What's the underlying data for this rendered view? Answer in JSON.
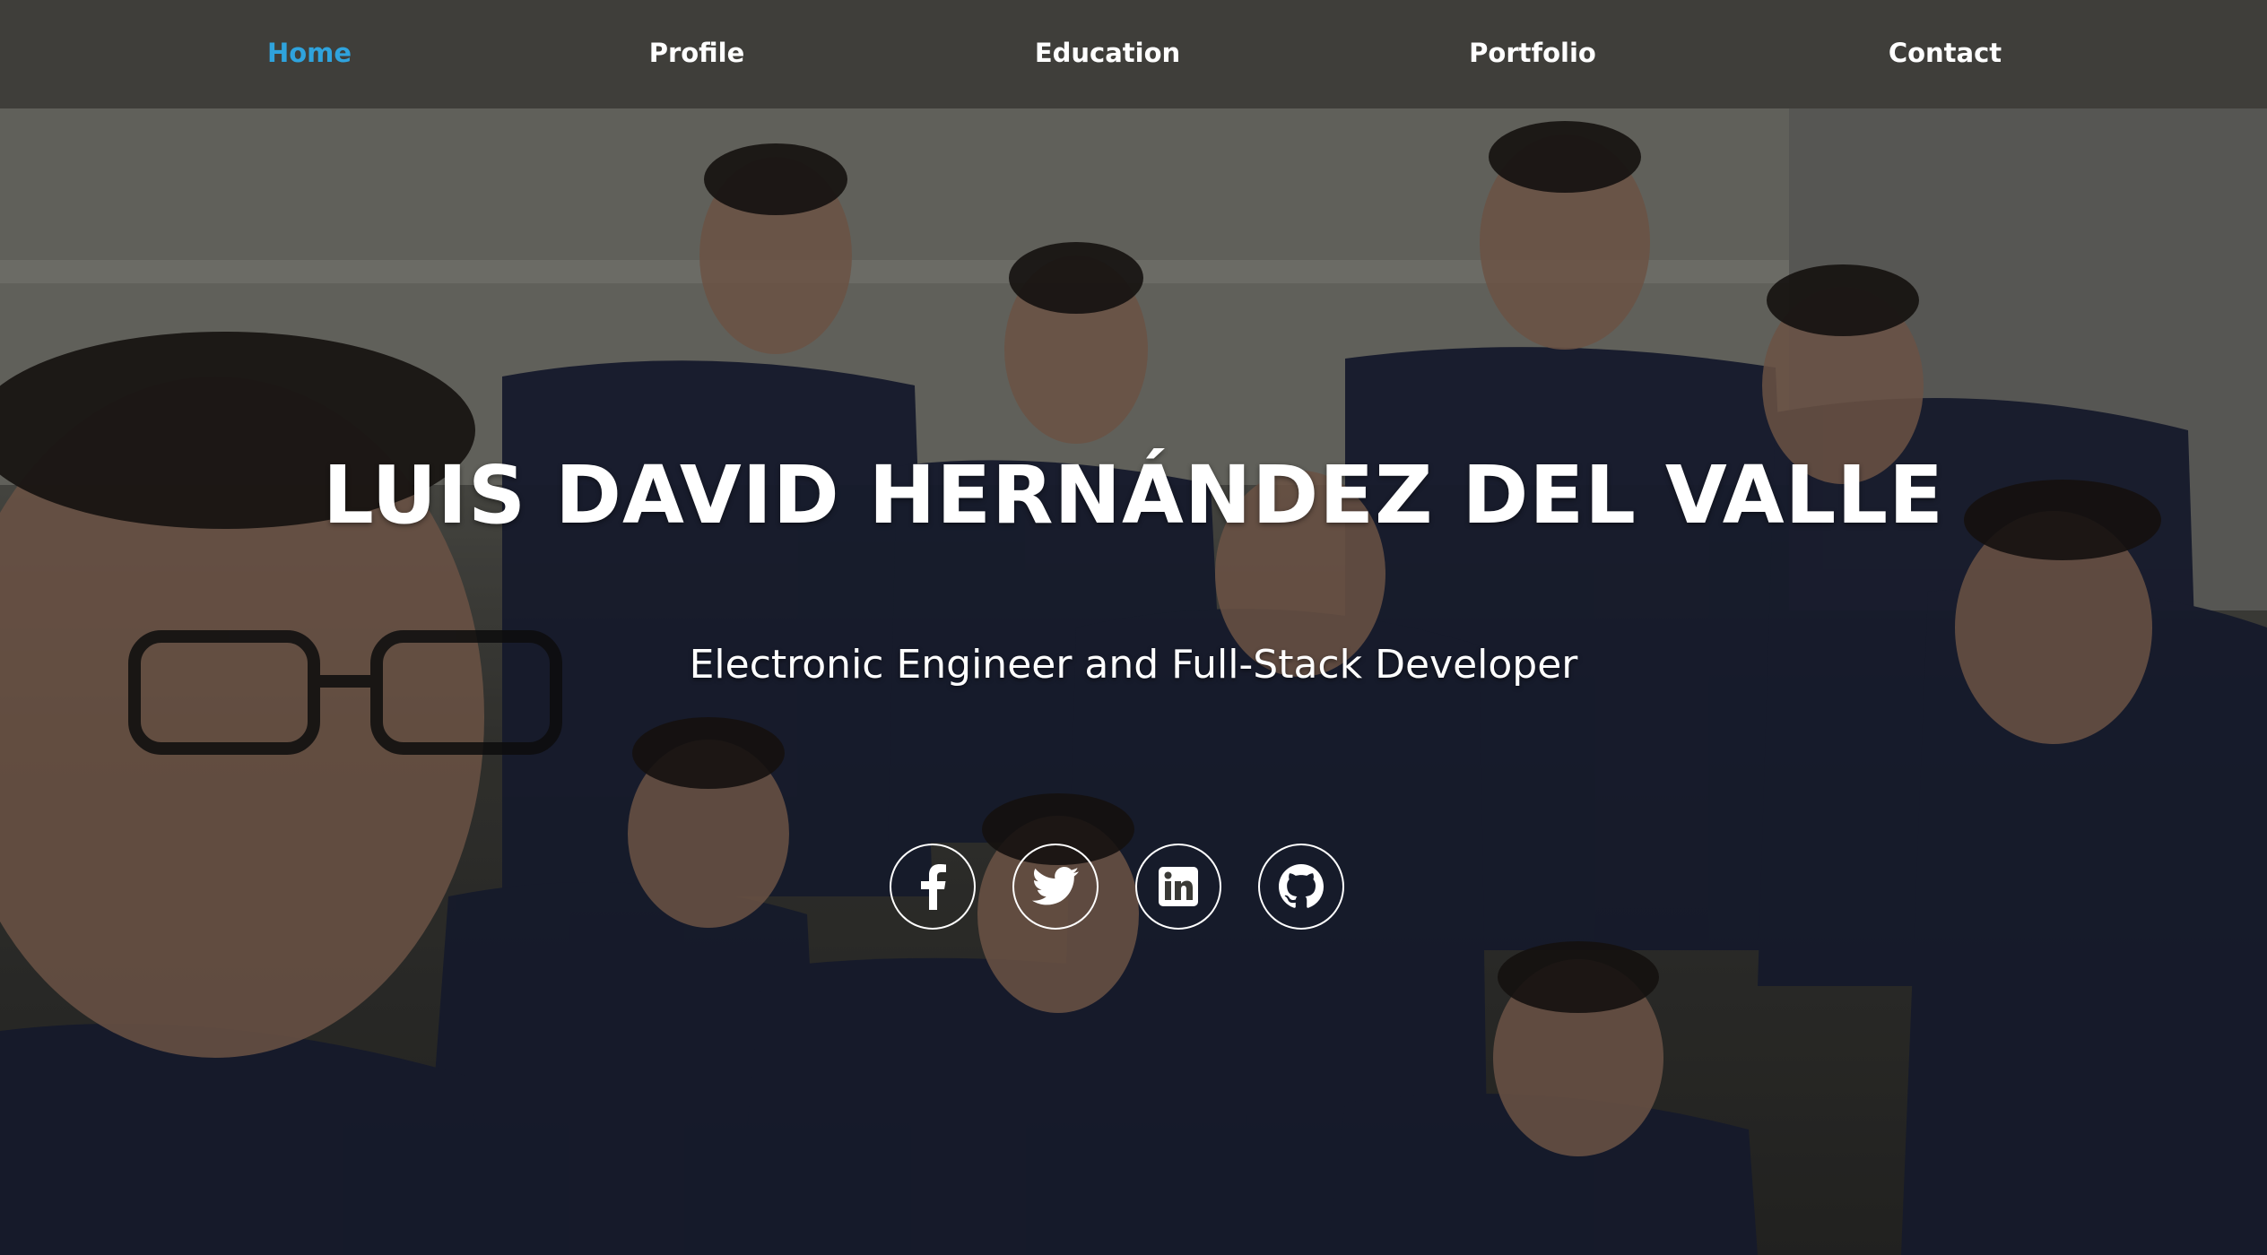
{
  "nav": {
    "items": [
      {
        "label": "Home",
        "active": true
      },
      {
        "label": "Profile",
        "active": false
      },
      {
        "label": "Education",
        "active": false
      },
      {
        "label": "Portfolio",
        "active": false
      },
      {
        "label": "Contact",
        "active": false
      }
    ]
  },
  "hero": {
    "title": "LUIS DAVID HERNÁNDEZ DEL VALLE",
    "subtitle": "Electronic Engineer and Full-Stack Developer"
  },
  "social": [
    {
      "icon": "facebook-icon"
    },
    {
      "icon": "twitter-icon"
    },
    {
      "icon": "linkedin-icon"
    },
    {
      "icon": "github-icon"
    }
  ],
  "colors": {
    "navbar_bg": "#3f3e3a",
    "nav_text": "#ffffff",
    "nav_active": "#2fa3dd",
    "hero_text": "#ffffff"
  }
}
